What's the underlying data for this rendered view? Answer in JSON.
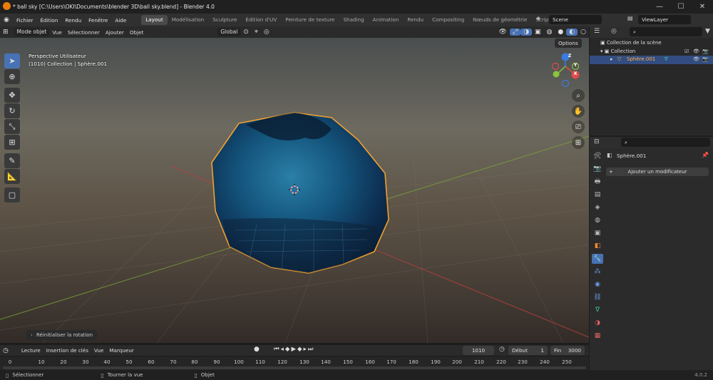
{
  "window": {
    "title": "* ball sky [C:\\Users\\OKI\\Documents\\blender 3D\\ball sky.blend] - Blender 4.0",
    "minimize": "—",
    "maximize": "☐",
    "close": "✕"
  },
  "menu": [
    "Fichier",
    "Édition",
    "Rendu",
    "Fenêtre",
    "Aide"
  ],
  "workspaces": [
    "Layout",
    "Modélisation",
    "Sculpture",
    "Édition d'UV",
    "Peinture de texture",
    "Shading",
    "Animation",
    "Rendu",
    "Compositing",
    "Nœuds de géométrie",
    "Scriptage"
  ],
  "workspace_add": "+",
  "scene": "Scene",
  "view_layer": "ViewLayer",
  "viewport_header": {
    "mode": "Mode objet",
    "menus": [
      "Vue",
      "Sélectionner",
      "Ajouter",
      "Objet"
    ],
    "orientation": "Global"
  },
  "viewport": {
    "info_line1": "Perspective Utilisateur",
    "info_line2": "(1010) Collection | Sphère.001",
    "options": "Options",
    "gizmo_x": "X",
    "gizmo_y": "Y",
    "gizmo_z": "Z",
    "last_op": "Réinitialiser la rotation"
  },
  "timeline": {
    "menus": [
      "Lecture",
      "Insertion de clés",
      "Vue",
      "Marqueur"
    ],
    "current_frame": "1010",
    "start_label": "Début",
    "start": "1",
    "end_label": "Fin",
    "end": "3000",
    "ruler": [
      "0",
      "10",
      "20",
      "30",
      "40",
      "50",
      "60",
      "70",
      "80",
      "90",
      "100",
      "110",
      "120",
      "130",
      "140",
      "150",
      "160",
      "170",
      "180",
      "190",
      "200",
      "210",
      "220",
      "230",
      "240",
      "250"
    ]
  },
  "status": {
    "select": "Sélectionner",
    "rotate": "Tourner la vue",
    "object": "Objet",
    "version": "4.0.2"
  },
  "outliner": {
    "scene_collection": "Collection de la scène",
    "collection": "Collection",
    "object": "Sphère.001"
  },
  "properties": {
    "object_name": "Sphère.001",
    "add_modifier": "Ajouter un modificateur"
  },
  "colors": {
    "accent": "#4772b3",
    "selection_outline": "#f0a030",
    "axis_x": "#e24a4a",
    "axis_y": "#8ac43b",
    "axis_z": "#3a7be0"
  },
  "icons": [
    "blender-logo-icon",
    "select-icon",
    "cursor-icon",
    "move-icon",
    "rotate-icon",
    "scale-icon",
    "transform-icon",
    "annotate-icon",
    "measure-icon",
    "add-cube-icon",
    "zoom-icon",
    "hand-icon",
    "camera-icon",
    "grid-icon",
    "eye-icon",
    "camera-render-icon",
    "wrench-icon"
  ]
}
